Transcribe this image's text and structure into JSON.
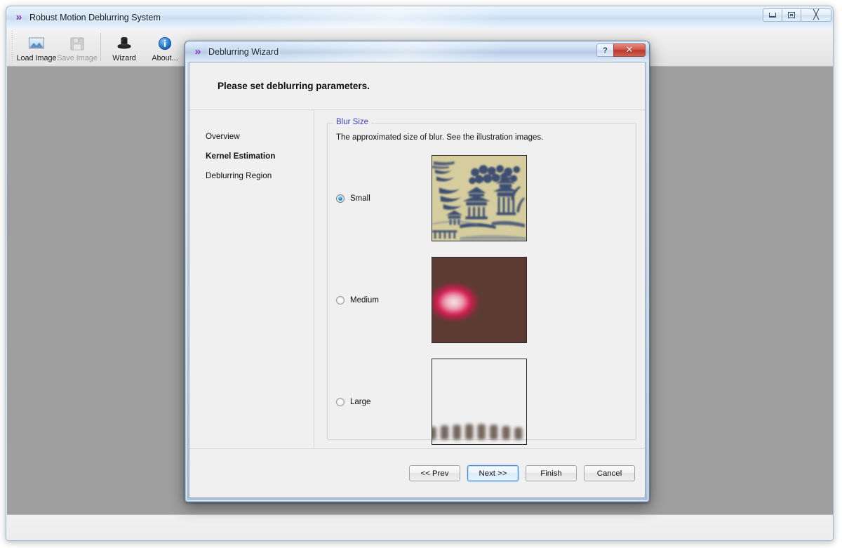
{
  "main_window": {
    "title": "Robust Motion Deblurring System",
    "app_icon": "chevron-double-right-icon",
    "window_controls": {
      "minimize": "minimize-icon",
      "maximize": "maximize-icon",
      "close": "close-icon"
    },
    "toolbar": {
      "items": [
        {
          "label": "Load Image",
          "icon": "open-image-icon",
          "enabled": true
        },
        {
          "label": "Save Image",
          "icon": "floppy-save-icon",
          "enabled": false
        },
        {
          "label": "Wizard",
          "icon": "top-hat-icon",
          "enabled": true
        },
        {
          "label": "About...",
          "icon": "info-circle-icon",
          "enabled": true
        }
      ]
    }
  },
  "dialog": {
    "title": "Deblurring Wizard",
    "icon": "chevron-double-right-icon",
    "help_button": "?",
    "close_button": "✕",
    "header": "Please set deblurring parameters.",
    "nav": {
      "items": [
        {
          "label": "Overview",
          "active": false
        },
        {
          "label": "Kernel Estimation",
          "active": true
        },
        {
          "label": "Deblurring Region",
          "active": false
        }
      ]
    },
    "group": {
      "legend": "Blur Size",
      "description": "The approximated size of blur. See the illustration images.",
      "options": [
        {
          "label": "Small",
          "selected": true,
          "thumbnail": "blue-willow-china-plate"
        },
        {
          "label": "Medium",
          "selected": false,
          "thumbnail": "blurred-pink-azalea-flowers"
        },
        {
          "label": "Large",
          "selected": false,
          "thumbnail": "blurred-colosseum-stone-arches"
        }
      ]
    },
    "footer": {
      "buttons": [
        {
          "label": "<< Prev",
          "default": false
        },
        {
          "label": "Next >>",
          "default": true
        },
        {
          "label": "Finish",
          "default": false
        },
        {
          "label": "Cancel",
          "default": false
        }
      ]
    }
  },
  "colors": {
    "accent_blue": "#3c8ddb",
    "legend_blue": "#3c3cc8",
    "close_red": "#b9382b",
    "canvas_gray": "#9f9f9f",
    "dialog_face": "#f0f0f0"
  }
}
